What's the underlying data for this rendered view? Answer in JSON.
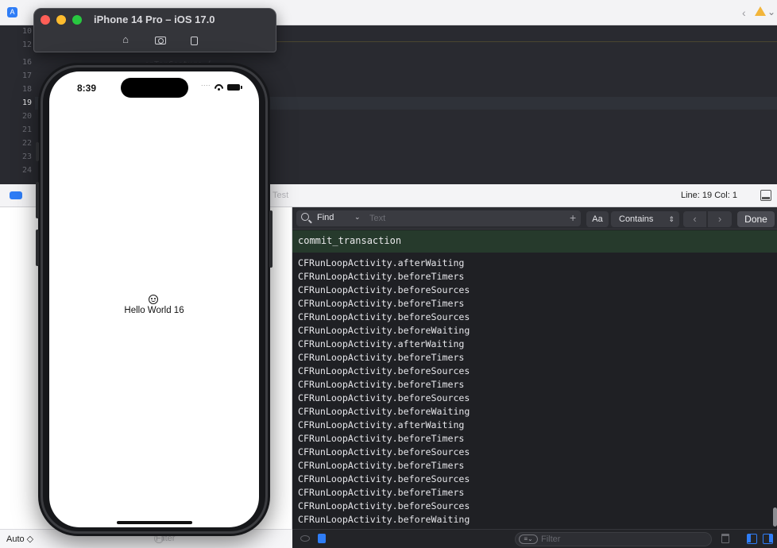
{
  "xcode": {
    "line_numbers": [
      "10",
      "12",
      "16",
      "17",
      "18",
      "19",
      "20",
      "21",
      "22",
      "23",
      "24"
    ],
    "current_line": "19",
    "ghost_code": "onTapGesture {",
    "faded_label": "Test",
    "line_col": "Line: 19  Col: 1",
    "auto_label": "Auto ◇",
    "left_filter_placeholder": "Filter"
  },
  "simulator": {
    "title": "iPhone 14 Pro – iOS 17.0",
    "status_time": "8:39",
    "signal": "....",
    "hello_text": "Hello World 16"
  },
  "console": {
    "find": {
      "mode": "Find",
      "placeholder": "Text",
      "plus": "+",
      "case_toggle": "Aa",
      "match_mode": "Contains",
      "prev": "‹",
      "next": "›",
      "done": "Done"
    },
    "header": "commit_transaction",
    "lines": [
      "CFRunLoopActivity.afterWaiting",
      "CFRunLoopActivity.beforeTimers",
      "CFRunLoopActivity.beforeSources",
      "CFRunLoopActivity.beforeTimers",
      "CFRunLoopActivity.beforeSources",
      "CFRunLoopActivity.beforeWaiting",
      "CFRunLoopActivity.afterWaiting",
      "CFRunLoopActivity.beforeTimers",
      "CFRunLoopActivity.beforeSources",
      "CFRunLoopActivity.beforeTimers",
      "CFRunLoopActivity.beforeSources",
      "CFRunLoopActivity.beforeWaiting",
      "CFRunLoopActivity.afterWaiting",
      "CFRunLoopActivity.beforeTimers",
      "CFRunLoopActivity.beforeSources",
      "CFRunLoopActivity.beforeTimers",
      "CFRunLoopActivity.beforeSources",
      "CFRunLoopActivity.beforeTimers",
      "CFRunLoopActivity.beforeSources",
      "CFRunLoopActivity.beforeWaiting"
    ],
    "filter_placeholder": "Filter"
  },
  "icons": {
    "app": "xcode-app-icon",
    "warning": "warning-icon",
    "home": "home-icon",
    "screenshot": "screenshot-icon",
    "rotate": "rotate-icon",
    "search": "search-icon",
    "smiley": "smiley-icon"
  },
  "colors": {
    "accent": "#2f7df6",
    "console_bg": "#1f2024",
    "header_bg": "#263a2c",
    "warning": "#f2b53a"
  }
}
